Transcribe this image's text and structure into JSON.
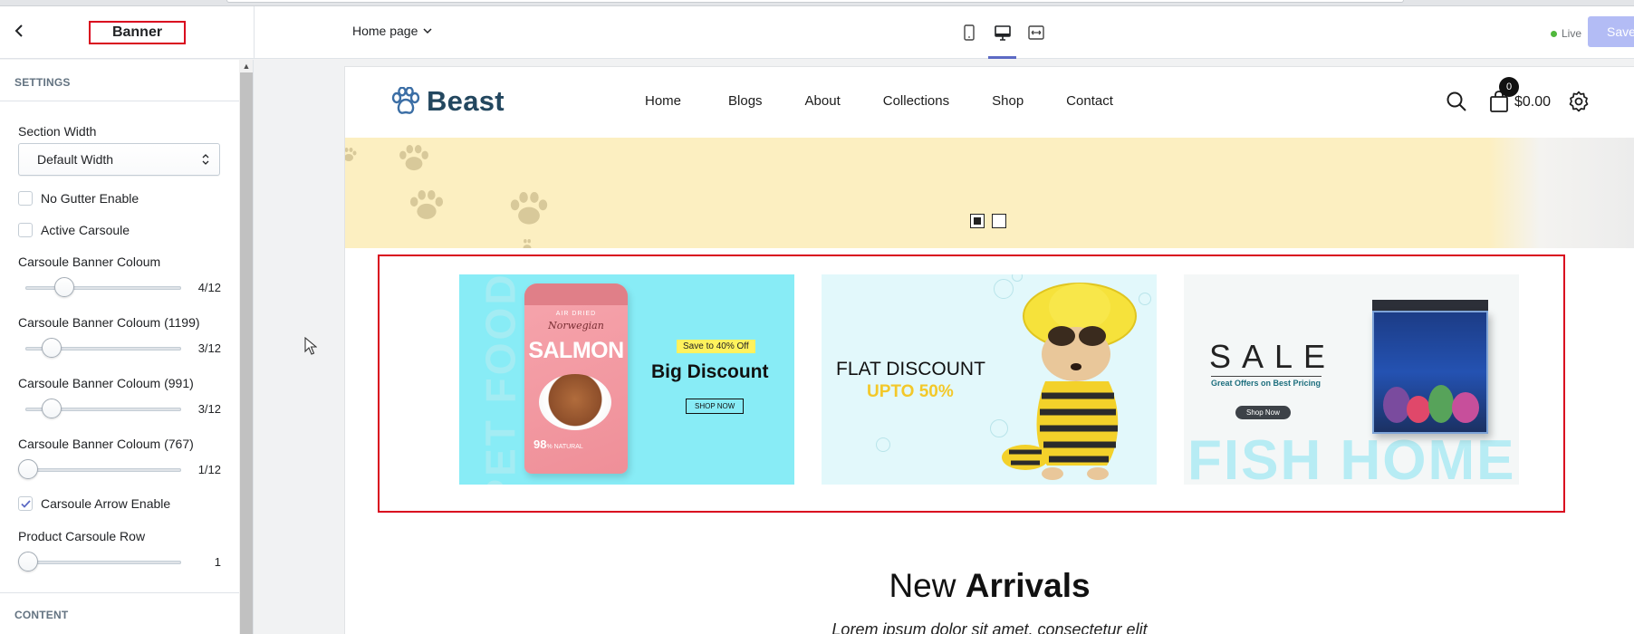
{
  "topbar": {
    "section_title": "Banner",
    "page_selector": "Home page",
    "live_label": "Live",
    "save_label": "Save"
  },
  "sidebar": {
    "settings_heading": "SETTINGS",
    "content_heading": "CONTENT",
    "section_width": {
      "label": "Section Width",
      "value": "Default Width"
    },
    "checkboxes": [
      {
        "label": "No Gutter Enable",
        "checked": false
      },
      {
        "label": "Active Carsoule",
        "checked": false
      },
      {
        "label": "Carsoule Arrow Enable",
        "checked": true
      }
    ],
    "sliders": [
      {
        "label": "Carsoule Banner Coloum",
        "value": "4/12",
        "fraction": 0.25
      },
      {
        "label": "Carsoule Banner Coloum (1199)",
        "value": "3/12",
        "fraction": 0.1667
      },
      {
        "label": "Carsoule Banner Coloum (991)",
        "value": "3/12",
        "fraction": 0.1667
      },
      {
        "label": "Carsoule Banner Coloum (767)",
        "value": "1/12",
        "fraction": 0
      },
      {
        "label": "Product Carsoule Row",
        "value": "1",
        "fraction": 0
      }
    ]
  },
  "store": {
    "logo": "Beast",
    "nav": [
      "Home",
      "Blogs",
      "About",
      "Collections",
      "Shop",
      "Contact"
    ],
    "cart_count": "0",
    "cart_total": "$0.00"
  },
  "banners": {
    "one": {
      "side_text": "PET FOOD",
      "pouch_brand": "AIR DRIED",
      "pouch_sub": "Norwegian",
      "pouch_title": "SALMON",
      "pouch_pct": "98",
      "pouch_pct_small": "% NATURAL",
      "tag": "Save to 40% Off",
      "headline": "Big Discount",
      "button": "SHOP NOW"
    },
    "two": {
      "headline": "FLAT DISCOUNT",
      "subline": "UPTO 50%"
    },
    "three": {
      "headline": "SALE",
      "subline": "Great Offers on Best Pricing",
      "button": "Shop Now",
      "bg_text": "FISH HOME"
    }
  },
  "arrivals": {
    "title_light": "New ",
    "title_bold": "Arrivals",
    "subtitle": "Lorem ipsum dolor sit amet, consectetur elit"
  },
  "colors": {
    "highlight": "#d9041e",
    "accent": "#5c6ac4",
    "save_disabled": "#b3bcf5",
    "live": "#50b83c",
    "hero_bg": "#fcefc1"
  }
}
